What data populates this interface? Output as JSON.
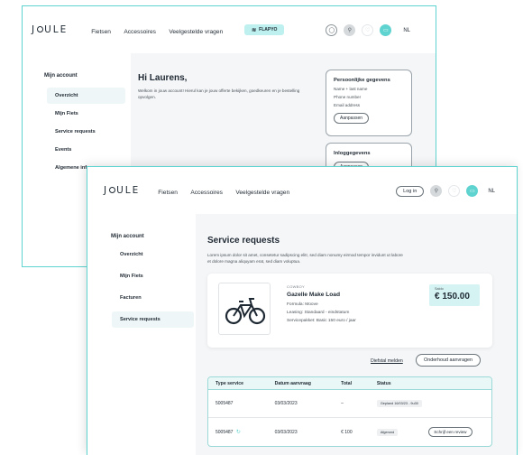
{
  "back": {
    "logo": "J",
    "logo_rest": "ULE",
    "nav": [
      "Fietsen",
      "Accessoires",
      "Veelgestelde vragen"
    ],
    "flapyo": "FLAPYO",
    "lang": "NL",
    "sidebar": {
      "title": "Mijn account",
      "items": [
        "Overzicht",
        "Mijn Fiets",
        "Service requests",
        "Events",
        "Algemene inf"
      ]
    },
    "greeting": "Hi Laurens,",
    "intro": "Welkom in jouw account! Hierul kan je jouw offerte bekijken, goedkeuren en je bestelling opvolgen.",
    "personal": {
      "title": "Persoonlijke gegevens",
      "lines": [
        "Name + last name",
        "Phone number",
        "Email address"
      ],
      "button": "Aanpassen"
    },
    "login": {
      "title": "Inloggegevens",
      "button": "Aanpassen"
    }
  },
  "front": {
    "logo": "J",
    "logo_rest": "ULE",
    "nav": [
      "Fietsen",
      "Accessoires",
      "Veelgestelde vragen"
    ],
    "login_button": "Log in",
    "lang": "NL",
    "sidebar": {
      "title": "Mijn account",
      "items": [
        "Overzicht",
        "Mijn Fiets",
        "Facturen",
        "Service requests"
      ]
    },
    "page_title": "Service requests",
    "description": "Lorem ipsum dolor sit amet, consetetur sadipscing elitr, sed diam nonumy eirmod tempor invidunt ut labore et dolore magna aliquyam erat, sed diam voluptua.",
    "bike": {
      "brand": "COWBOY",
      "name": "Gazelle Make Load",
      "formula": "Formula:  Moove",
      "leasing": "Leasing:  Standaard - eindstatum",
      "service": "Servicepakket:  Basic 150 euro / jaar",
      "price_label": "Saldo",
      "price": "€ 150.00"
    },
    "report_link": "Diefstal melden",
    "maintenance_button": "Onderhoud aanvragen",
    "table": {
      "headers": [
        "Type service",
        "Datum aanvraag",
        "Total",
        "Status"
      ],
      "rows": [
        {
          "type": "5005487",
          "date": "03/03/2023",
          "total": "–",
          "status": "Gepland 16/03/23 - 9u30",
          "action": ""
        },
        {
          "type": "5005487",
          "date": "03/03/2023",
          "total": "€ 100",
          "status": "Afgerond",
          "action": "Schrijf een review"
        }
      ]
    }
  },
  "colors": {
    "accent": "#5fd3cf",
    "accent_light": "#d5f3f2"
  }
}
